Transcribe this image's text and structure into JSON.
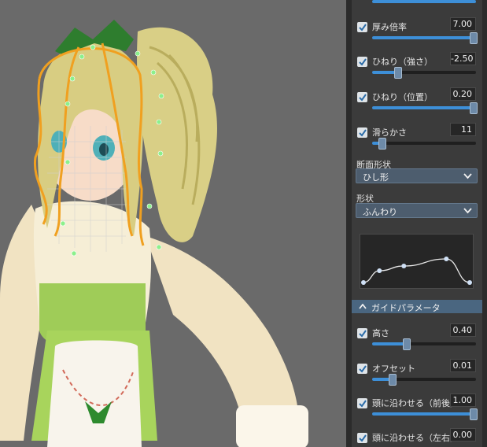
{
  "params": [
    {
      "label": "厚み倍率",
      "value": "7.00",
      "level": 0.98
    },
    {
      "label": "ひねり（強さ）",
      "value": "-2.50",
      "level": 0.25
    },
    {
      "label": "ひねり（位置）",
      "value": "0.20",
      "level": 0.98
    },
    {
      "label": "滑らかさ",
      "value": "11",
      "level": 0.1
    }
  ],
  "section_shape": {
    "label": "断面形状",
    "selected": "ひし形"
  },
  "shape": {
    "label": "形状",
    "selected": "ふんわり"
  },
  "curve_points": [
    [
      0.0,
      0.05
    ],
    [
      0.15,
      0.3
    ],
    [
      0.38,
      0.4
    ],
    [
      0.78,
      0.55
    ],
    [
      1.0,
      0.05
    ]
  ],
  "guide_header": "ガイドパラメータ",
  "guide_params": [
    {
      "label": "高さ",
      "value": "0.40",
      "level": 0.33
    },
    {
      "label": "オフセット",
      "value": "0.01",
      "level": 0.2
    },
    {
      "label": "頭に沿わせる（前後）",
      "value": "1.00",
      "level": 0.98
    },
    {
      "label": "頭に沿わせる（左右）",
      "value": "0.00",
      "level": 0.0
    }
  ],
  "colors": {
    "accent": "#3d8fd8",
    "panel": "#3b3b3b",
    "guide_line": "#f0a020",
    "viewport": "#6a6a6a"
  }
}
